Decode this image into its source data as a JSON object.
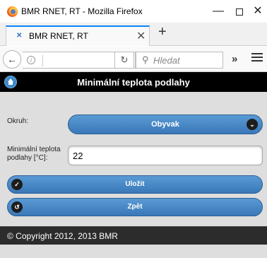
{
  "window": {
    "title": "BMR RNET, RT - Mozilla Firefox",
    "minimize_glyph": "—",
    "close_glyph": "✕"
  },
  "tab": {
    "title": "BMR RNET, RT",
    "close_glyph": "✕",
    "icon": "bmr-favicon-icon",
    "new_tab_glyph": "+"
  },
  "navbar": {
    "back_glyph": "←",
    "info_glyph": "i",
    "reload_glyph": "↻",
    "search_glyph": "🔍",
    "search_placeholder": "Hledat",
    "overflow_glyph": "»"
  },
  "page": {
    "title": "Minimální teplota podlahy",
    "okruh_label": "Okruh:",
    "okruh_value": "Obyvak",
    "select_arrow_glyph": "⌄",
    "min_temp_label": "Minimální teplota podlahy [°C]:",
    "min_temp_value": "22",
    "save_label": "Uložit",
    "save_icon_glyph": "✓",
    "back_label": "Zpět",
    "back_icon_glyph": "↺",
    "footer": "© Copyright 2012, 2013 BMR"
  },
  "colors": {
    "accent_tab": "#0a84ff",
    "button_blue": "#3a78b8",
    "header_bg": "#000000",
    "footer_bg": "#2c2c2c",
    "page_bg": "#dedede"
  }
}
